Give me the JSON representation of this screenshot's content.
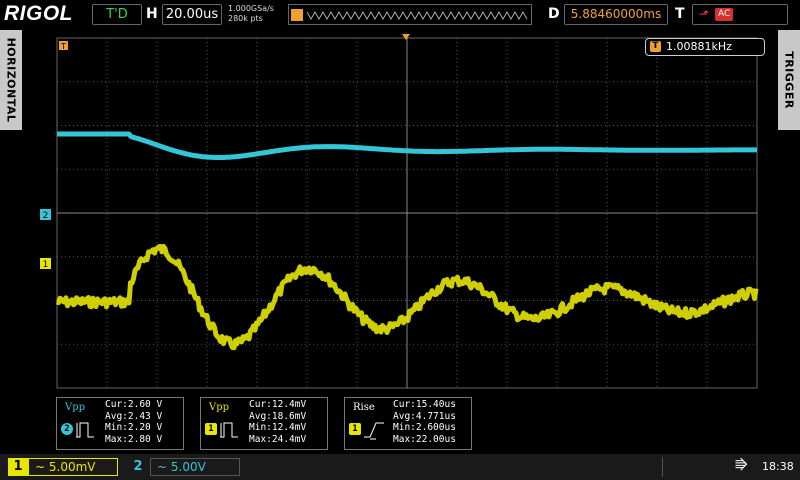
{
  "brand": "RIGOL",
  "status": "T'D",
  "horizontal": {
    "letter": "H",
    "timebase": "20.00us",
    "sample_rate": "1.000GSa/s",
    "memory_depth": "280k pts"
  },
  "delay": {
    "letter": "D",
    "offset": "5.88460000ms"
  },
  "trigger": {
    "letter": "T",
    "source": "AC",
    "edge_icon": "rising-edge-icon"
  },
  "side_tabs": {
    "left": "HORIZONTAL",
    "right": "TRIGGER"
  },
  "markers": {
    "ch1": "1",
    "ch2": "2",
    "trigger_flag": "T"
  },
  "frequency": {
    "icon": "T",
    "value": "1.00881kHz"
  },
  "measurements": [
    {
      "name": "Vpp",
      "channel": "2",
      "color": "#33c6d6",
      "icon": "pulse-icon",
      "cur": "Cur:2.60 V",
      "avg": "Avg:2.43 V",
      "min": "Min:2.20 V",
      "max": "Max:2.80 V"
    },
    {
      "name": "Vpp",
      "channel": "1",
      "color": "#e6e600",
      "icon": "pulse-icon",
      "cur": "Cur:12.4mV",
      "avg": "Avg:18.6mV",
      "min": "Min:12.4mV",
      "max": "Max:24.4mV"
    },
    {
      "name": "Rise",
      "channel": "1",
      "color": "#e6e600",
      "icon": "rise-edge-icon",
      "cur": "Cur:15.40us",
      "avg": "Avg:4.771us",
      "min": "Min:2.600us",
      "max": "Max:22.00us"
    }
  ],
  "channels": {
    "ch1": {
      "number": "1",
      "scale": "~ 5.00mV",
      "color": "#e6e600"
    },
    "ch2": {
      "number": "2",
      "scale": "~  5.00V",
      "color": "#33c6d6"
    }
  },
  "clock": "18:38",
  "usb_icon": "usb-icon",
  "colors": {
    "ch1": "#e6e600",
    "ch2": "#33c6d6",
    "trigger": "#f0a030",
    "status": "#3ad14a"
  }
}
